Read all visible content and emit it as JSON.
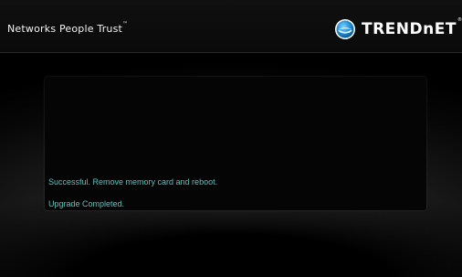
{
  "header": {
    "tagline": "Networks People Trust",
    "tagline_tm": "™",
    "brand_name": "TRENDnET",
    "brand_tm": "®"
  },
  "status": {
    "message_success": "Successful. Remove memory card and reboot.",
    "message_complete": "Upgrade Completed."
  },
  "colors": {
    "status_text": "#57c3c2",
    "background": "#000000",
    "logo_blue": "#1f8fd6"
  },
  "icons": {
    "logo": "trendnet-globe-logo-icon"
  }
}
